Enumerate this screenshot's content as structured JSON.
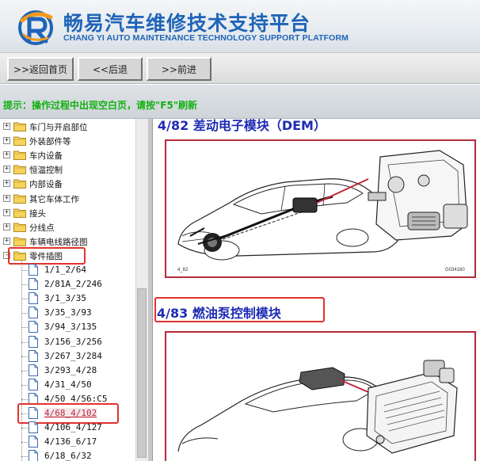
{
  "header": {
    "title_cn": "畅易汽车维修技术支持平台",
    "title_en": "CHANG YI AUTO MAINTENANCE TECHNOLOGY SUPPORT PLATFORM",
    "brand_colors": {
      "blue": "#1f64b8",
      "orange": "#f39a1c"
    }
  },
  "nav": {
    "home_label": ">>返回首页",
    "back_label": "<<后退",
    "forward_label": ">>前进"
  },
  "tip": {
    "text": "提示：操作过程中出现空白页，请按\"F5\"刷新",
    "color": "#12b012"
  },
  "tree": {
    "folders": [
      {
        "label": "车门与开启部位",
        "expander": "+"
      },
      {
        "label": "外装部件等",
        "expander": "+"
      },
      {
        "label": "车内设备",
        "expander": "+"
      },
      {
        "label": "恒温控制",
        "expander": "+"
      },
      {
        "label": "内部设备",
        "expander": "+"
      },
      {
        "label": "其它车体工作",
        "expander": "+"
      },
      {
        "label": "接头",
        "expander": "+"
      },
      {
        "label": "分线点",
        "expander": "+"
      },
      {
        "label": "车辆电线路径图",
        "expander": "+"
      },
      {
        "label": "零件插图",
        "expander": "-"
      }
    ],
    "documents": [
      "1/1_2/64",
      "2/81A_2/246",
      "3/1_3/35",
      "3/35_3/93",
      "3/94_3/135",
      "3/156_3/256",
      "3/267_3/284",
      "3/293_4/28",
      "4/31_4/50",
      "4/50_4/56:C5",
      "4/68_4/102",
      "4/106_4/127",
      "4/136_6/17",
      "6/18_6/32"
    ],
    "selected_document": "4/68_4/102"
  },
  "content": {
    "section1_title": "4/82    差动电子模块（DEM）",
    "figure1_code_left": "4_82",
    "figure1_code_right": "G034160",
    "section2_title": "4/83    燃油泵控制模块",
    "accent_title_color": "#1e2bb3",
    "figure_border_color": "#b22b3a",
    "highlight_color": "#e2322e"
  }
}
